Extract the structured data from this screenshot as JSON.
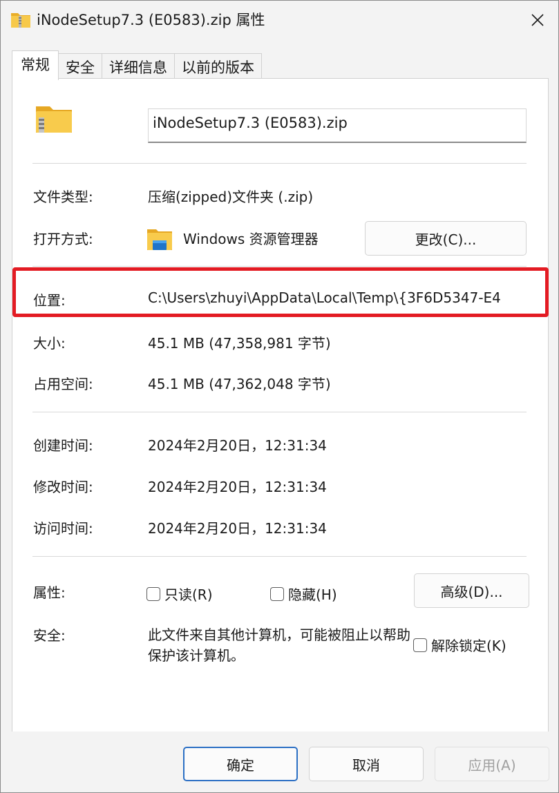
{
  "window": {
    "title": "iNodeSetup7.3 (E0583).zip 属性",
    "close_icon": "close-icon"
  },
  "tabs": [
    {
      "label": "常规",
      "active": true
    },
    {
      "label": "安全",
      "active": false
    },
    {
      "label": "详细信息",
      "active": false
    },
    {
      "label": "以前的版本",
      "active": false
    }
  ],
  "general": {
    "file_name": "iNodeSetup7.3 (E0583).zip",
    "file_icon": "zip-folder-icon",
    "type_label": "文件类型:",
    "type_value": "压缩(zipped)文件夹 (.zip)",
    "opener_label": "打开方式:",
    "opener_icon": "file-explorer-icon",
    "opener_value": "Windows 资源管理器",
    "change_button": "更改(C)...",
    "location_label": "位置:",
    "location_value": "C:\\Users\\zhuyi\\AppData\\Local\\Temp\\{3F6D5347-E4",
    "size_label": "大小:",
    "size_value": "45.1 MB (47,358,981 字节)",
    "disk_size_label": "占用空间:",
    "disk_size_value": "45.1 MB (47,362,048 字节)",
    "created_label": "创建时间:",
    "created_value": "2024年2月20日，12:31:34",
    "modified_label": "修改时间:",
    "modified_value": "2024年2月20日，12:31:34",
    "accessed_label": "访问时间:",
    "accessed_value": "2024年2月20日，12:31:34",
    "attributes_label": "属性:",
    "readonly_label": "只读(R)",
    "hidden_label": "隐藏(H)",
    "advanced_button": "高级(D)...",
    "security_label": "安全:",
    "security_text": "此文件来自其他计算机，可能被阻止以帮助保护该计算机。",
    "unblock_label": "解除锁定(K)"
  },
  "footer": {
    "ok": "确定",
    "cancel": "取消",
    "apply": "应用(A)"
  },
  "colors": {
    "highlight": "#e31b23",
    "folder_yellow": "#f4c542",
    "primary_border": "#2b6fc4"
  }
}
